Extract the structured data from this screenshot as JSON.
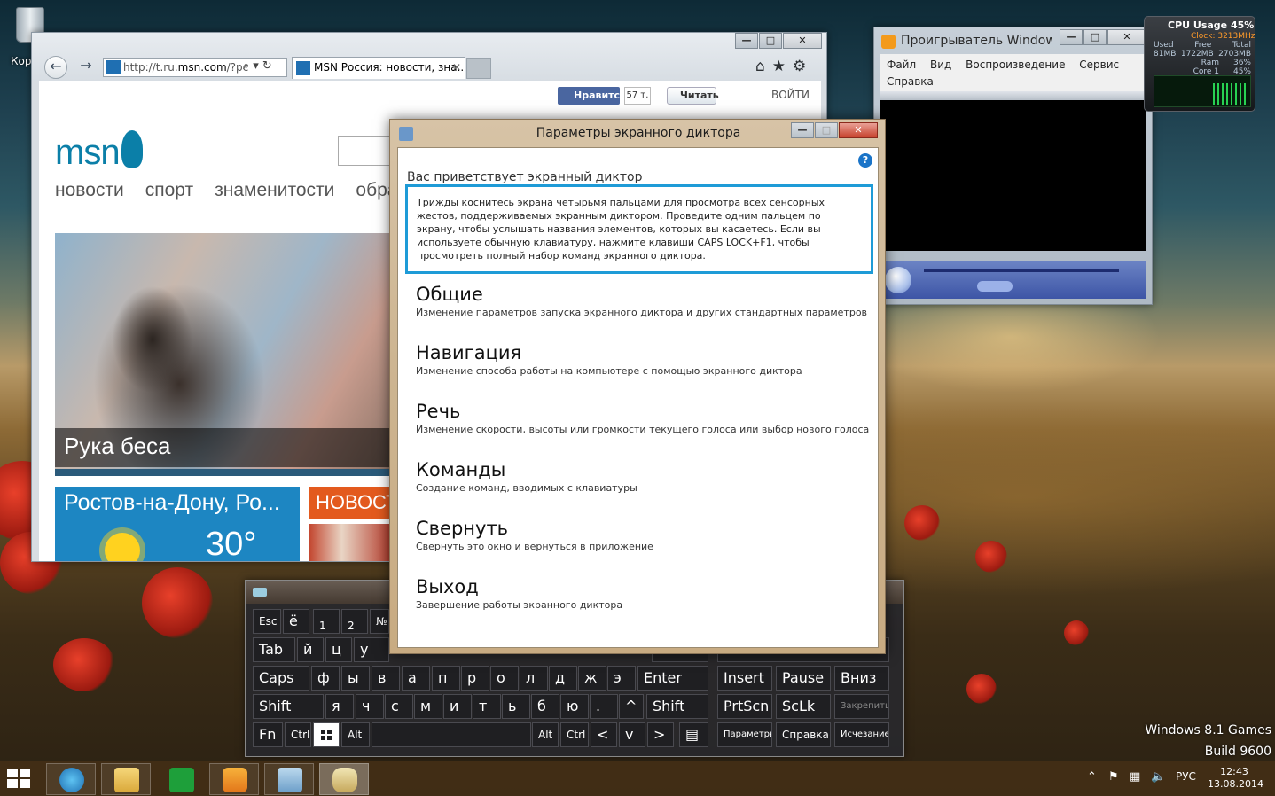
{
  "desktop": {
    "recycle_label": "Кор"
  },
  "ie": {
    "address_prefix": "http://t.ru.",
    "address_host": "msn.com",
    "address_suffix": "/?pc",
    "tab_title": "MSN Россия: новости, зна...",
    "tab_close": "✕",
    "controls": {
      "minimize": "—",
      "maximize": "□",
      "close": "✕"
    },
    "page": {
      "fb_like": "Нравится",
      "fb_count": "57 т.",
      "tweet": "Читать",
      "login": "ВОЙТИ",
      "logo": "msn",
      "nav": [
        "новости",
        "спорт",
        "знаменитости",
        "обра"
      ],
      "hero_caption": "Рука беса",
      "weather_city": "Ростов-на-Дону, Ро...",
      "weather_temp": "30°",
      "news_tile": "НОВОСТ"
    }
  },
  "wmp": {
    "title": "Проигрыватель Windows",
    "menu": [
      "Файл",
      "Вид",
      "Воспроизведение",
      "Сервис",
      "Справка"
    ]
  },
  "cpu": {
    "header": "CPU Usage  45%",
    "clock": "Clock: 3213MHz",
    "labels": [
      "Used",
      "Free",
      "Total"
    ],
    "values": [
      "81MB",
      "1722MB",
      "2703MB"
    ],
    "ram_label": "Ram",
    "ram_value": "36%",
    "core_label": "Core 1",
    "core_value": "45%"
  },
  "narrator": {
    "title": "Параметры экранного диктора",
    "welcome": "Вас приветствует экранный диктор",
    "info": "Трижды коснитесь экрана четырьмя пальцами для просмотра всех сенсорных жестов, поддерживаемых экранным диктором. Проведите одним пальцем по экрану, чтобы услышать названия элементов, которых вы касаетесь. Если вы используете обычную клавиатуру, нажмите клавиши CAPS LOCK+F1, чтобы просмотреть полный набор команд экранного диктора.",
    "help": "?",
    "options": [
      {
        "title": "Общие",
        "desc": "Изменение параметров запуска экранного диктора и других стандартных параметров"
      },
      {
        "title": "Навигация",
        "desc": "Изменение способа работы на компьютере с помощью экранного диктора"
      },
      {
        "title": "Речь",
        "desc": "Изменение скорости, высоты или громкости текущего голоса или выбор нового голоса"
      },
      {
        "title": "Команды",
        "desc": "Создание команд, вводимых с клавиатуры"
      },
      {
        "title": "Свернуть",
        "desc": "Свернуть это окно и вернуться в приложение"
      },
      {
        "title": "Выход",
        "desc": "Завершение работы экранного диктора"
      }
    ]
  },
  "keyboard": {
    "row1": [
      "Esc",
      "ё",
      "1",
      "2",
      "№"
    ],
    "row2": [
      "Tab",
      "й",
      "ц",
      "у"
    ],
    "row3": [
      "Caps",
      "ф",
      "ы",
      "в",
      "а",
      "п",
      "р",
      "о",
      "л",
      "д",
      "ж",
      "э",
      "Enter"
    ],
    "row4": [
      "Shift",
      "я",
      "ч",
      "с",
      "м",
      "и",
      "т",
      "ь",
      "б",
      "ю",
      ".",
      "^",
      "Shift"
    ],
    "row5": [
      "Fn",
      "Ctrl",
      "",
      "Alt",
      "",
      "Alt",
      "Ctrl",
      "<",
      "v",
      ">",
      "▤"
    ],
    "nav_keys": [
      "Insert",
      "Pause",
      "Вниз",
      "PrtScn",
      "ScLk",
      "Закрепить",
      "Параметры",
      "Справка",
      "Исчезание"
    ]
  },
  "watermark": {
    "line1": "Windows 8.1 Games",
    "line2": "Build 9600"
  },
  "taskbar": {
    "lang": "РУС",
    "time": "12:43",
    "date": "13.08.2014"
  }
}
